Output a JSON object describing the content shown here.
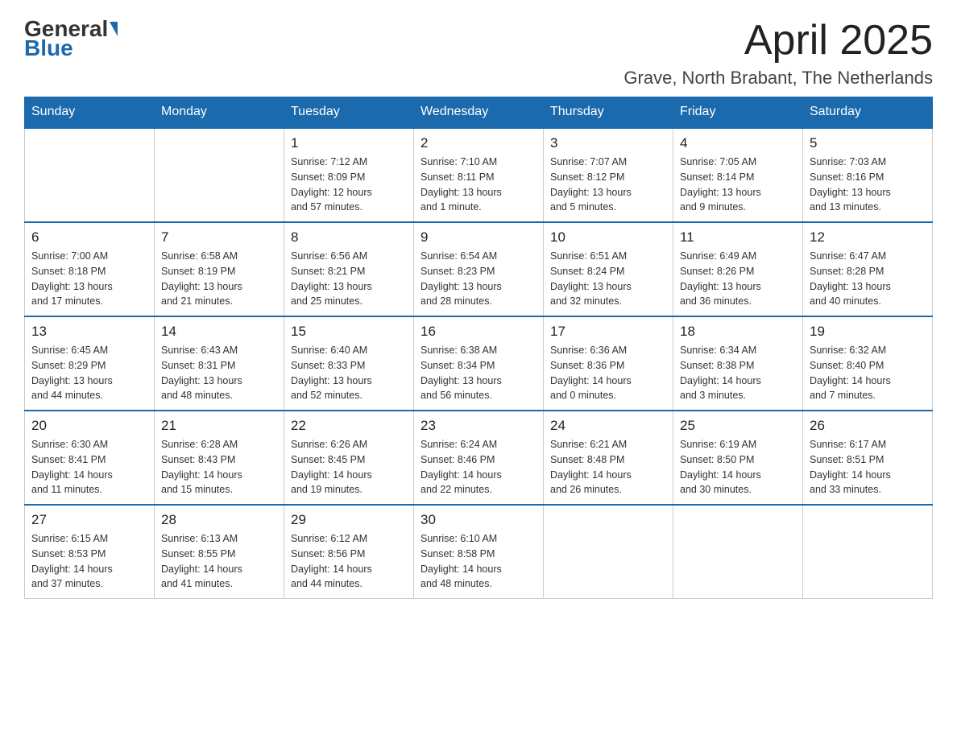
{
  "header": {
    "logo_general": "General",
    "logo_blue": "Blue",
    "month_year": "April 2025",
    "location": "Grave, North Brabant, The Netherlands"
  },
  "days_of_week": [
    "Sunday",
    "Monday",
    "Tuesday",
    "Wednesday",
    "Thursday",
    "Friday",
    "Saturday"
  ],
  "weeks": [
    [
      {
        "day": "",
        "info": ""
      },
      {
        "day": "",
        "info": ""
      },
      {
        "day": "1",
        "info": "Sunrise: 7:12 AM\nSunset: 8:09 PM\nDaylight: 12 hours\nand 57 minutes."
      },
      {
        "day": "2",
        "info": "Sunrise: 7:10 AM\nSunset: 8:11 PM\nDaylight: 13 hours\nand 1 minute."
      },
      {
        "day": "3",
        "info": "Sunrise: 7:07 AM\nSunset: 8:12 PM\nDaylight: 13 hours\nand 5 minutes."
      },
      {
        "day": "4",
        "info": "Sunrise: 7:05 AM\nSunset: 8:14 PM\nDaylight: 13 hours\nand 9 minutes."
      },
      {
        "day": "5",
        "info": "Sunrise: 7:03 AM\nSunset: 8:16 PM\nDaylight: 13 hours\nand 13 minutes."
      }
    ],
    [
      {
        "day": "6",
        "info": "Sunrise: 7:00 AM\nSunset: 8:18 PM\nDaylight: 13 hours\nand 17 minutes."
      },
      {
        "day": "7",
        "info": "Sunrise: 6:58 AM\nSunset: 8:19 PM\nDaylight: 13 hours\nand 21 minutes."
      },
      {
        "day": "8",
        "info": "Sunrise: 6:56 AM\nSunset: 8:21 PM\nDaylight: 13 hours\nand 25 minutes."
      },
      {
        "day": "9",
        "info": "Sunrise: 6:54 AM\nSunset: 8:23 PM\nDaylight: 13 hours\nand 28 minutes."
      },
      {
        "day": "10",
        "info": "Sunrise: 6:51 AM\nSunset: 8:24 PM\nDaylight: 13 hours\nand 32 minutes."
      },
      {
        "day": "11",
        "info": "Sunrise: 6:49 AM\nSunset: 8:26 PM\nDaylight: 13 hours\nand 36 minutes."
      },
      {
        "day": "12",
        "info": "Sunrise: 6:47 AM\nSunset: 8:28 PM\nDaylight: 13 hours\nand 40 minutes."
      }
    ],
    [
      {
        "day": "13",
        "info": "Sunrise: 6:45 AM\nSunset: 8:29 PM\nDaylight: 13 hours\nand 44 minutes."
      },
      {
        "day": "14",
        "info": "Sunrise: 6:43 AM\nSunset: 8:31 PM\nDaylight: 13 hours\nand 48 minutes."
      },
      {
        "day": "15",
        "info": "Sunrise: 6:40 AM\nSunset: 8:33 PM\nDaylight: 13 hours\nand 52 minutes."
      },
      {
        "day": "16",
        "info": "Sunrise: 6:38 AM\nSunset: 8:34 PM\nDaylight: 13 hours\nand 56 minutes."
      },
      {
        "day": "17",
        "info": "Sunrise: 6:36 AM\nSunset: 8:36 PM\nDaylight: 14 hours\nand 0 minutes."
      },
      {
        "day": "18",
        "info": "Sunrise: 6:34 AM\nSunset: 8:38 PM\nDaylight: 14 hours\nand 3 minutes."
      },
      {
        "day": "19",
        "info": "Sunrise: 6:32 AM\nSunset: 8:40 PM\nDaylight: 14 hours\nand 7 minutes."
      }
    ],
    [
      {
        "day": "20",
        "info": "Sunrise: 6:30 AM\nSunset: 8:41 PM\nDaylight: 14 hours\nand 11 minutes."
      },
      {
        "day": "21",
        "info": "Sunrise: 6:28 AM\nSunset: 8:43 PM\nDaylight: 14 hours\nand 15 minutes."
      },
      {
        "day": "22",
        "info": "Sunrise: 6:26 AM\nSunset: 8:45 PM\nDaylight: 14 hours\nand 19 minutes."
      },
      {
        "day": "23",
        "info": "Sunrise: 6:24 AM\nSunset: 8:46 PM\nDaylight: 14 hours\nand 22 minutes."
      },
      {
        "day": "24",
        "info": "Sunrise: 6:21 AM\nSunset: 8:48 PM\nDaylight: 14 hours\nand 26 minutes."
      },
      {
        "day": "25",
        "info": "Sunrise: 6:19 AM\nSunset: 8:50 PM\nDaylight: 14 hours\nand 30 minutes."
      },
      {
        "day": "26",
        "info": "Sunrise: 6:17 AM\nSunset: 8:51 PM\nDaylight: 14 hours\nand 33 minutes."
      }
    ],
    [
      {
        "day": "27",
        "info": "Sunrise: 6:15 AM\nSunset: 8:53 PM\nDaylight: 14 hours\nand 37 minutes."
      },
      {
        "day": "28",
        "info": "Sunrise: 6:13 AM\nSunset: 8:55 PM\nDaylight: 14 hours\nand 41 minutes."
      },
      {
        "day": "29",
        "info": "Sunrise: 6:12 AM\nSunset: 8:56 PM\nDaylight: 14 hours\nand 44 minutes."
      },
      {
        "day": "30",
        "info": "Sunrise: 6:10 AM\nSunset: 8:58 PM\nDaylight: 14 hours\nand 48 minutes."
      },
      {
        "day": "",
        "info": ""
      },
      {
        "day": "",
        "info": ""
      },
      {
        "day": "",
        "info": ""
      }
    ]
  ]
}
